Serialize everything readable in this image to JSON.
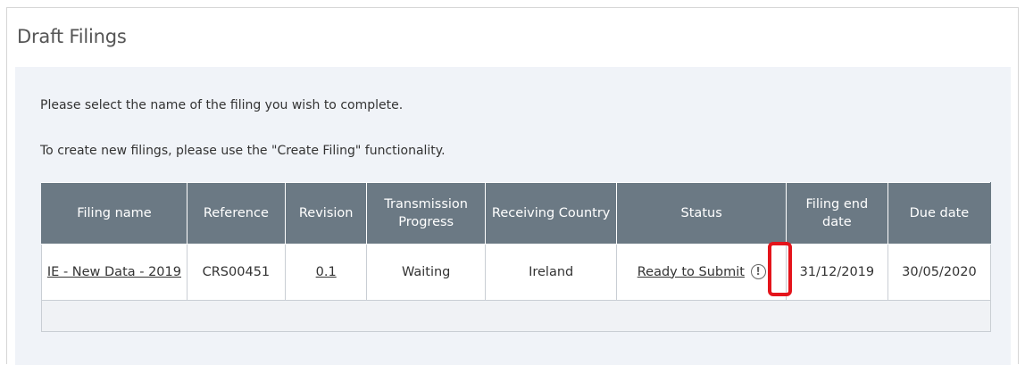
{
  "panel": {
    "title": "Draft Filings",
    "instruction_1": "Please select the name of the filing you wish to complete.",
    "instruction_2": "To create new filings, please use the \"Create Filing\" functionality."
  },
  "table": {
    "headers": {
      "filing_name": "Filing name",
      "reference": "Reference",
      "revision": "Revision",
      "transmission_progress": "Transmission Progress",
      "receiving_country": "Receiving Country",
      "status": "Status",
      "filing_end_date": "Filing end date",
      "due_date": "Due date"
    },
    "rows": [
      {
        "filing_name": "IE - New Data - 2019",
        "reference": "CRS00451",
        "revision": "0.1",
        "transmission_progress": "Waiting",
        "receiving_country": "Ireland",
        "status": "Ready to Submit",
        "filing_end_date": "31/12/2019",
        "due_date": "30/05/2020"
      }
    ]
  },
  "icons": {
    "status_warning": "exclamation-circle-icon"
  },
  "colors": {
    "header_bg": "#6b7984",
    "panel_bg": "#f0f3f8",
    "highlight": "#e4141b"
  }
}
